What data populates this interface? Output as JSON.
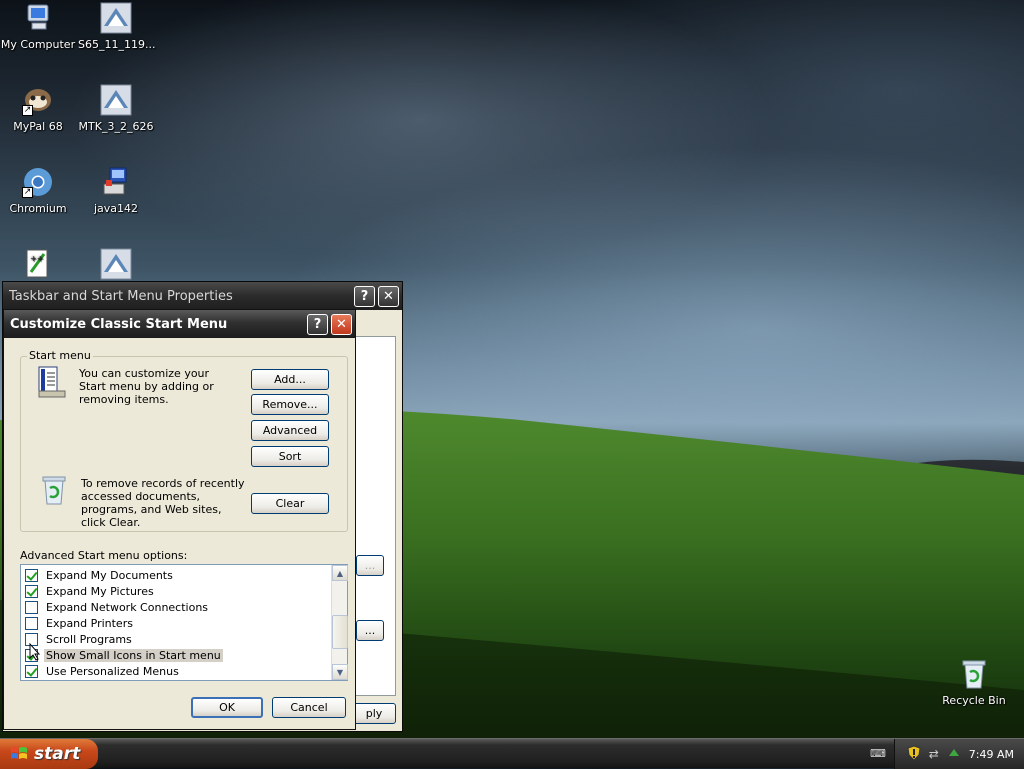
{
  "desktop": {
    "icons": [
      {
        "label": "My Computer"
      },
      {
        "label": "S65_11_119..."
      },
      {
        "label": "MyPal 68"
      },
      {
        "label": "MTK_3_2_626"
      },
      {
        "label": "Chromium"
      },
      {
        "label": "java142"
      },
      {
        "label": ""
      },
      {
        "label": ""
      },
      {
        "label": "Recycle Bin"
      }
    ]
  },
  "back_window": {
    "title": "Taskbar and Start Menu Properties",
    "help_symbol": "?",
    "close_symbol": "✕",
    "partial_button_1": "...",
    "partial_button_2": "...",
    "partial_apply": "ply"
  },
  "dialog": {
    "title": "Customize Classic Start Menu",
    "help_symbol": "?",
    "close_symbol": "✕",
    "start_menu_group": {
      "label": "Start menu",
      "customize_text": "You can customize your Start menu by adding or removing items.",
      "add_button": "Add...",
      "remove_button": "Remove...",
      "advanced_button": "Advanced",
      "sort_button": "Sort",
      "clear_text": "To remove records of recently accessed documents, programs, and Web sites, click Clear.",
      "clear_button": "Clear"
    },
    "options_label": "Advanced Start menu options:",
    "options": [
      {
        "label": "Expand My Documents",
        "checked": true
      },
      {
        "label": "Expand My Pictures",
        "checked": true
      },
      {
        "label": "Expand Network Connections",
        "checked": false
      },
      {
        "label": "Expand Printers",
        "checked": false
      },
      {
        "label": "Scroll Programs",
        "checked": false
      },
      {
        "label": "Show Small Icons in Start menu",
        "checked": true
      },
      {
        "label": "Use Personalized Menus",
        "checked": true
      }
    ],
    "ok_button": "OK",
    "cancel_button": "Cancel"
  },
  "taskbar": {
    "start_label": "start",
    "clock": "7:49 AM"
  },
  "colors": {
    "dialog_face": "#ece9d8",
    "start_button": "#c8481a",
    "checkmark": "#21a121"
  }
}
